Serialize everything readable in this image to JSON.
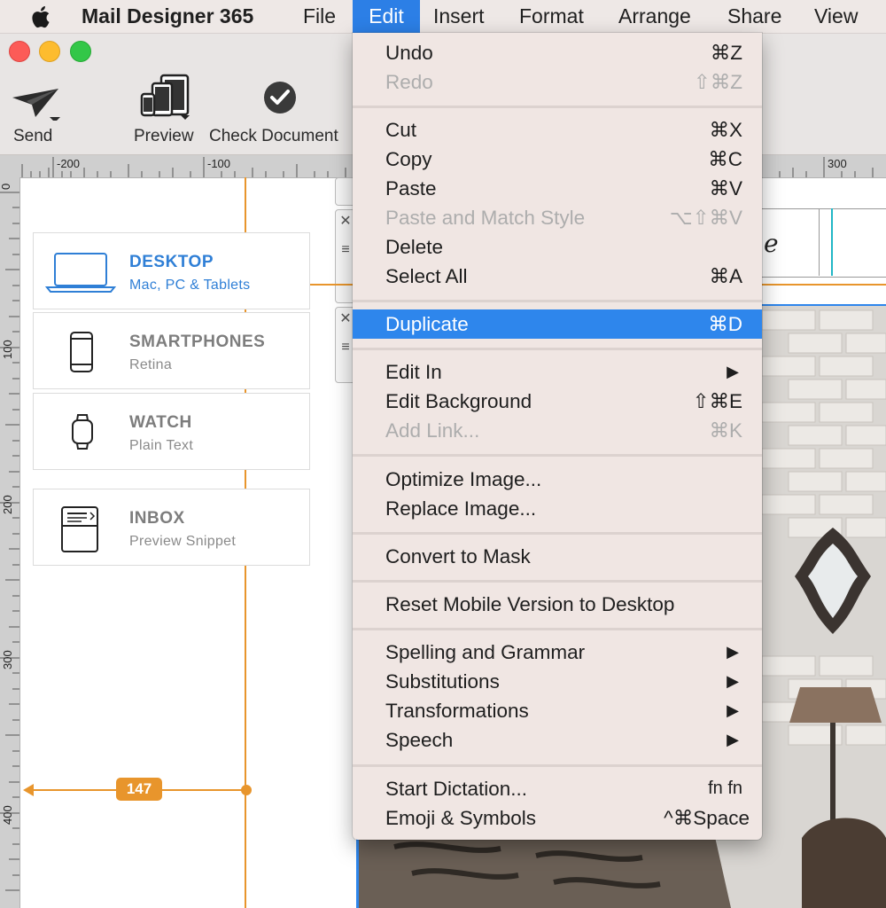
{
  "menubar": {
    "app_name": "Mail Designer 365",
    "items": [
      "File",
      "Edit",
      "Insert",
      "Format",
      "Arrange",
      "Share",
      "View"
    ]
  },
  "toolbar": {
    "send_label": "Send",
    "preview_label": "Preview",
    "check_label": "Check Document"
  },
  "ruler": {
    "h_ticks": [
      "-200",
      "-100",
      "300"
    ],
    "v_ticks": [
      "0",
      "100",
      "200",
      "300",
      "400"
    ]
  },
  "devices": [
    {
      "title": "DESKTOP",
      "subtitle": "Mac, PC & Tablets",
      "icon": "laptop-icon",
      "selected": true
    },
    {
      "title": "SMARTPHONES",
      "subtitle": "Retina",
      "icon": "smartphone-icon",
      "selected": false
    },
    {
      "title": "WATCH",
      "subtitle": "Plain Text",
      "icon": "watch-icon",
      "selected": false
    },
    {
      "title": "INBOX",
      "subtitle": "Preview Snippet",
      "icon": "inbox-icon",
      "selected": false
    }
  ],
  "guide": {
    "measurement": "147"
  },
  "edit_menu": {
    "items": [
      {
        "label": "Undo",
        "shortcut": "⌘Z"
      },
      {
        "label": "Redo",
        "shortcut": "⇧⌘Z",
        "disabled": true
      },
      {
        "label": "Cut",
        "shortcut": "⌘X"
      },
      {
        "label": "Copy",
        "shortcut": "⌘C"
      },
      {
        "label": "Paste",
        "shortcut": "⌘V"
      },
      {
        "label": "Paste and Match Style",
        "shortcut": "⌥⇧⌘V",
        "disabled": true
      },
      {
        "label": "Delete",
        "shortcut": ""
      },
      {
        "label": "Select All",
        "shortcut": "⌘A"
      },
      {
        "label": "Duplicate",
        "shortcut": "⌘D",
        "highlighted": true
      },
      {
        "label": "Edit In",
        "shortcut": "▶"
      },
      {
        "label": "Edit Background",
        "shortcut": "⇧⌘E"
      },
      {
        "label": "Add Link...",
        "shortcut": "⌘K",
        "disabled": true
      },
      {
        "label": "Optimize Image...",
        "shortcut": ""
      },
      {
        "label": "Replace Image...",
        "shortcut": ""
      },
      {
        "label": "Convert to Mask",
        "shortcut": ""
      },
      {
        "label": "Reset Mobile Version to Desktop",
        "shortcut": ""
      },
      {
        "label": "Spelling and Grammar",
        "shortcut": "▶"
      },
      {
        "label": "Substitutions",
        "shortcut": "▶"
      },
      {
        "label": "Transformations",
        "shortcut": "▶"
      },
      {
        "label": "Speech",
        "shortcut": "▶"
      },
      {
        "label": "Start Dictation...",
        "shortcut": "fn fn"
      },
      {
        "label": "Emoji & Symbols",
        "shortcut": "^⌘Space"
      }
    ]
  },
  "colors": {
    "accent": "#2e86ec",
    "guide": "#e8952c",
    "desktop_selected": "#2f7fd6"
  }
}
